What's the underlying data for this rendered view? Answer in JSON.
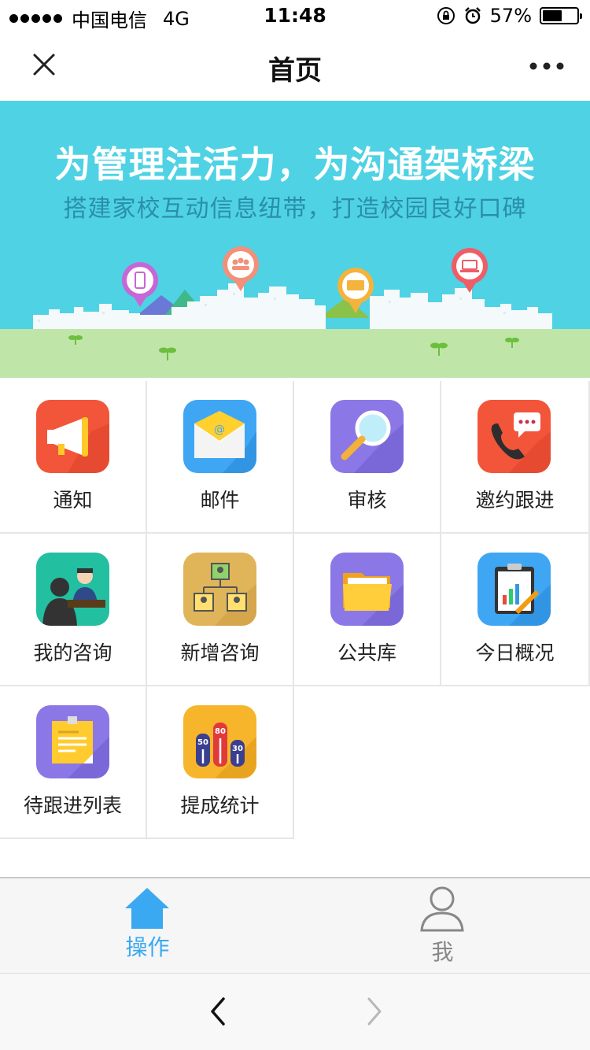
{
  "status_bar": {
    "carrier": "中国电信",
    "network": "4G",
    "time": "11:48",
    "battery": "57%",
    "battery_level": 0.57
  },
  "nav": {
    "title": "首页",
    "close_icon": "close-icon",
    "more_icon": "more-icon"
  },
  "banner": {
    "title": "为管理注活力，为沟通架桥梁",
    "subtitle": "搭建家校互动信息纽带，打造校园良好口碑",
    "colors": {
      "sky": "#4fd2e4",
      "grass": "#bfe6a8"
    }
  },
  "menu": {
    "items": [
      {
        "label": "通知",
        "icon": "megaphone-icon",
        "color": "#f2553a"
      },
      {
        "label": "邮件",
        "icon": "mail-icon",
        "color": "#3fa6f4"
      },
      {
        "label": "审核",
        "icon": "magnifier-icon",
        "color": "#8b78e6"
      },
      {
        "label": "邀约跟进",
        "icon": "phone-icon",
        "color": "#f2553a"
      },
      {
        "label": "我的咨询",
        "icon": "consult-icon",
        "color": "#22bfa0"
      },
      {
        "label": "新增咨询",
        "icon": "org-chart-icon",
        "color": "#e0b55a"
      },
      {
        "label": "公共库",
        "icon": "folder-icon",
        "color": "#8b78e6"
      },
      {
        "label": "今日概况",
        "icon": "clipboard-chart-icon",
        "color": "#3fa6f4"
      },
      {
        "label": "待跟进列表",
        "icon": "note-icon",
        "color": "#8b78e6"
      },
      {
        "label": "提成统计",
        "icon": "bar-stats-icon",
        "color": "#f7b52c"
      }
    ],
    "stats_numbers": [
      "50",
      "80",
      "30"
    ]
  },
  "tabbar": {
    "tabs": [
      {
        "label": "操作",
        "icon": "home-icon",
        "active": true
      },
      {
        "label": "我",
        "icon": "user-icon",
        "active": false
      }
    ],
    "active_color": "#3aa9f2",
    "inactive_color": "#888888"
  },
  "browser": {
    "back_icon": "back-arrow-icon",
    "forward_icon": "forward-arrow-icon"
  }
}
